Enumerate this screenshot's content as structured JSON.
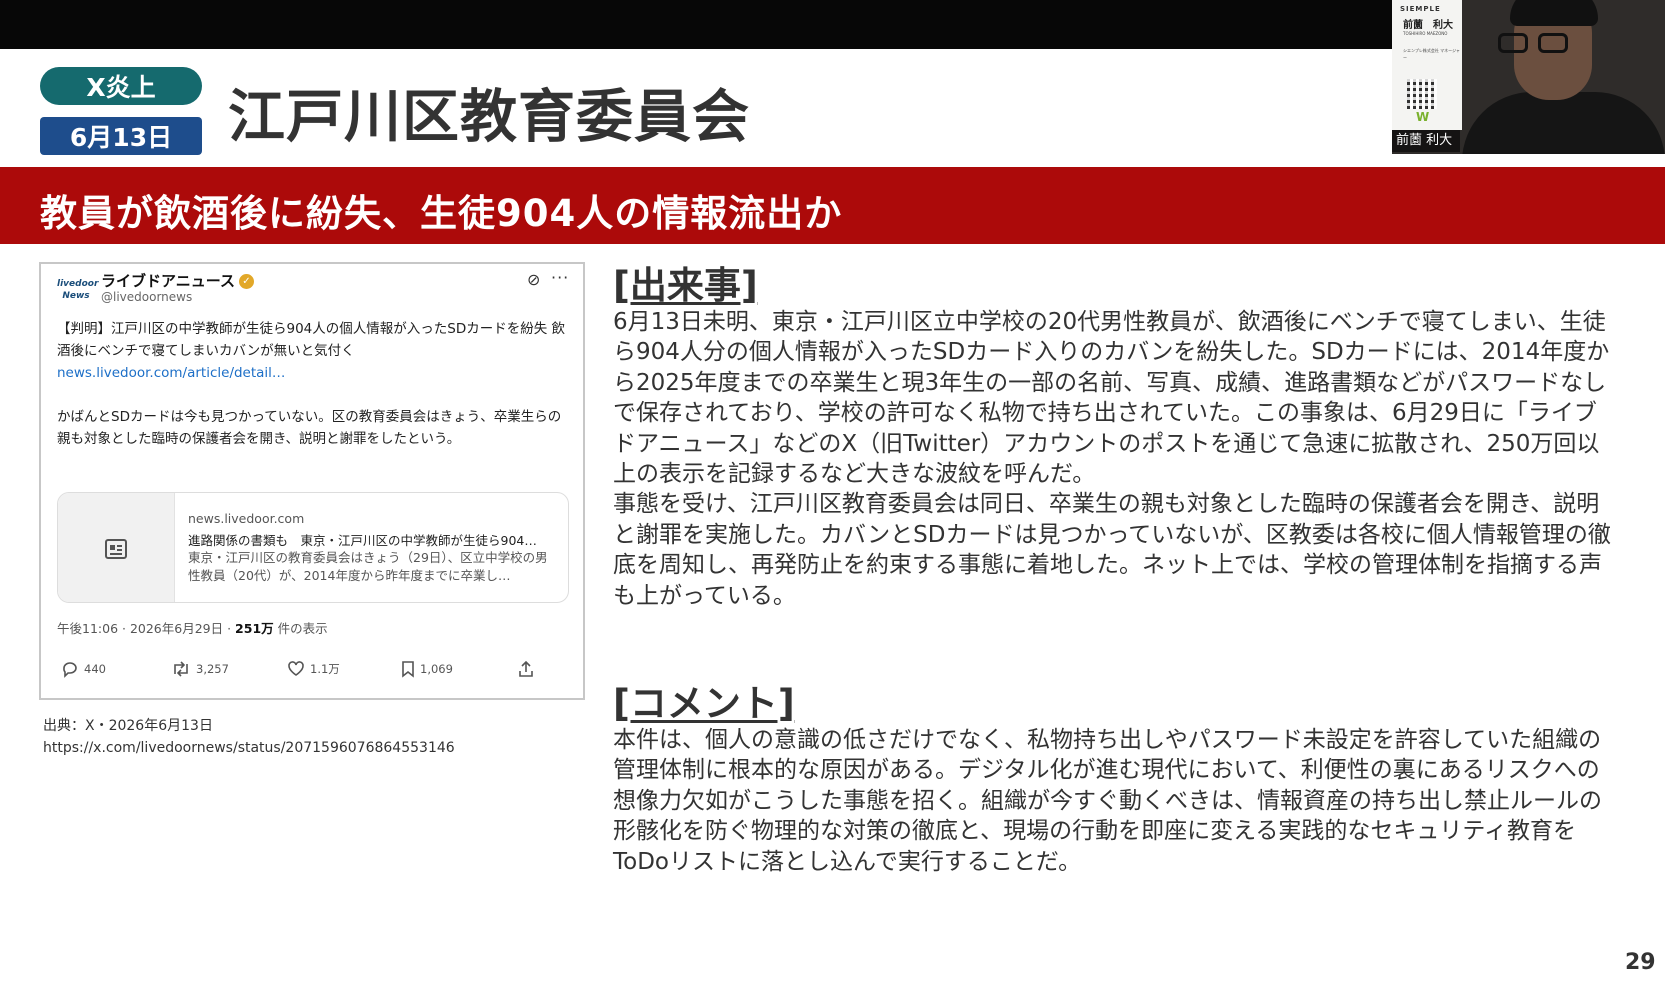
{
  "slide": {
    "tag_x": "X炎上",
    "tag_date": "6月13日",
    "org_title": "江戸川区教育委員会",
    "headline": "教員が飲酒後に紛失、生徒904人の情報流出か",
    "page_number": "29"
  },
  "tweet": {
    "logo": "livedoor News",
    "name": "ライブドアニュース",
    "handle": "@livedoornews",
    "body_1": "【判明】江戸川区の中学教師が生徒ら904人の個人情報が入ったSDカードを紛失 飲酒後にベンチで寝てしまいカバンが無いと気付く",
    "link": "news.livedoor.com/article/detail…",
    "body_2": "かばんとSDカードは今も見つかっていない。区の教育委員会はきょう、卒業生らの親も対象とした臨時の保護者会を開き、説明と謝罪をしたという。",
    "card_domain": "news.livedoor.com",
    "card_title": "進路関係の書類も　東京・江戸川区の中学教師が生徒ら904…",
    "card_desc": "東京・江戸川区の教育委員会はきょう（29日）、区立中学校の男性教員（20代）が、2014年度から昨年度までに卒業し…",
    "meta_time": "午後11:06 · 2026年6月29日 · ",
    "meta_views": "251万",
    "meta_views_suffix": " 件の表示",
    "replies": "440",
    "reposts": "3,257",
    "likes": "1.1万",
    "bookmarks": "1,069"
  },
  "source": {
    "line1": "出典：X・2026年6月13日",
    "line2": "https://x.com/livedoornews/status/2071596076864553146"
  },
  "event": {
    "heading": "[出来事]",
    "p1": "6月13日未明、東京・江戸川区立中学校の20代男性教員が、飲酒後にベンチで寝てしまい、生徒ら904人分の個人情報が入ったSDカード入りのカバンを紛失した。SDカードには、2014年度から2025年度までの卒業生と現3年生の一部の名前、写真、成績、進路書類などがパスワードなしで保存されており、学校の許可なく私物で持ち出されていた。この事象は、6月29日に「ライブドアニュース」などのX（旧Twitter）アカウントのポストを通じて急速に拡散され、250万回以上の表示を記録するなど大きな波紋を呼んだ。",
    "p2": "事態を受け、江戸川区教育委員会は同日、卒業生の親も対象とした臨時の保護者会を開き、説明と謝罪を実施した。カバンとSDカードは見つかっていないが、区教委は各校に個人情報管理の徹底を周知し、再発防止を約束する事態に着地した。ネット上では、学校の管理体制を指摘する声も上がっている。"
  },
  "comment": {
    "heading": "[コメント]",
    "p1": "本件は、個人の意識の低さだけでなく、私物持ち出しやパスワード未設定を許容していた組織の管理体制に根本的な原因がある。デジタル化が進む現代において、利便性の裏にあるリスクへの想像力欠如がこうした事態を招く。組織が今すぐ動くべきは、情報資産の持ち出し禁止ルールの形骸化を防ぐ物理的な対策の徹底と、現場の行動を即座に変える実践的なセキュリティ教育をToDoリストに落とし込んで実行することだ。"
  },
  "video": {
    "card_brand": "SIEMPLE",
    "card_name": "前薗　利大",
    "card_roman": "TOSHIHIRO MAEZONO",
    "card_company": "シエンプレ株式会社 マネージャー",
    "caption": "前薗 利大"
  },
  "icons": [
    "verified-icon",
    "grok-icon",
    "more-icon",
    "article-icon",
    "reply-icon",
    "repost-icon",
    "like-icon",
    "bookmark-icon",
    "share-icon"
  ]
}
